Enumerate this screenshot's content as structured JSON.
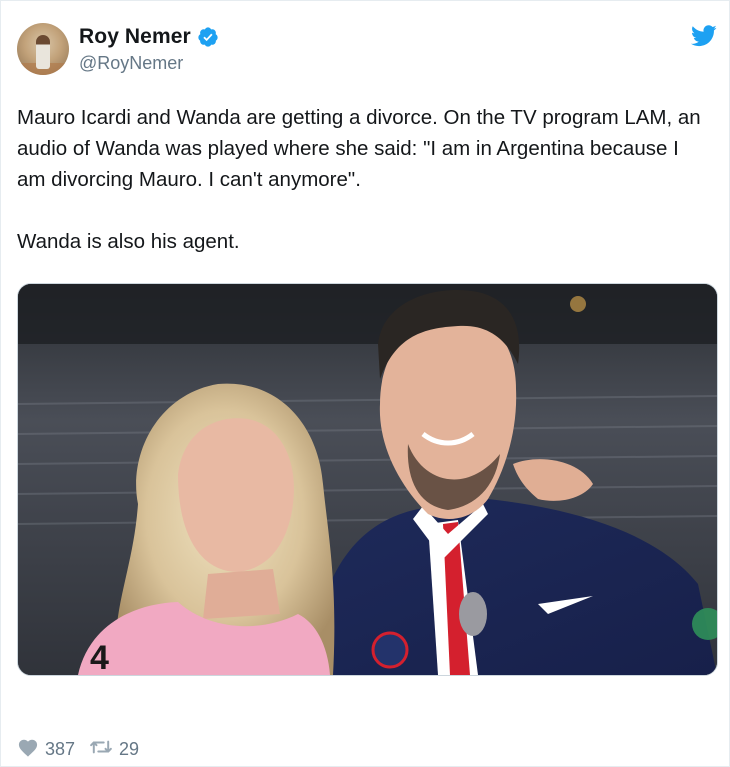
{
  "author": {
    "display_name": "Roy Nemer",
    "handle": "@RoyNemer",
    "verified": true,
    "avatar_icon": "user-avatar-photo"
  },
  "platform_icon": "twitter-bird-icon",
  "colors": {
    "brand": "#1da1f2",
    "text": "#14171a",
    "muted": "#657786"
  },
  "tweet": {
    "text": "Mauro Icardi and Wanda are getting a divorce. On the TV program LAM, an audio of Wanda was played where she said: \"I am in Argentina because I am divorcing Mauro. I can't anymore\".\n\nWanda is also his agent."
  },
  "media": {
    "jersey_number": "4"
  },
  "stats": {
    "likes": "387",
    "retweets": "29"
  }
}
